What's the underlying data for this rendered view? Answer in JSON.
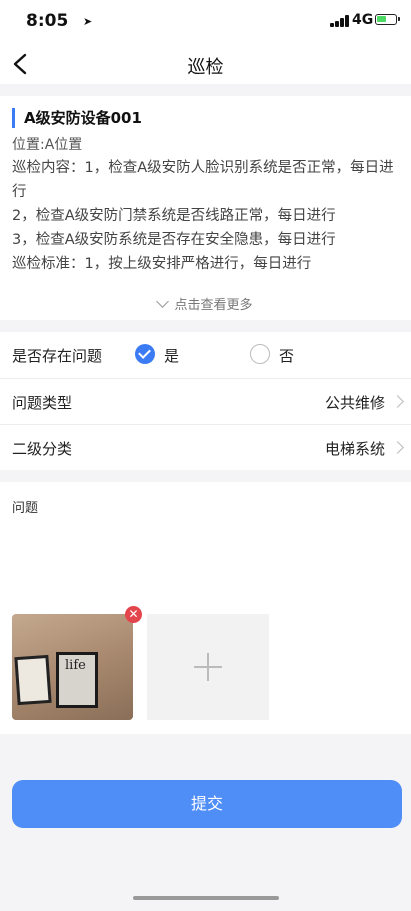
{
  "status_bar": {
    "time": "8:05",
    "network": "4G"
  },
  "nav": {
    "title": "巡检"
  },
  "device": {
    "title": "A级安防设备001",
    "location": "位置:A位置",
    "content_lines": [
      "巡检内容：1，检查A级安防人脸识别系统是否正常，每日进行",
      "2，检查A级安防门禁系统是否线路正常，每日进行",
      "3，检查A级安防系统是否存在安全隐患，每日进行",
      "巡检标准：1，按上级安排严格进行，每日进行"
    ],
    "more_label": "点击查看更多"
  },
  "form": {
    "has_problem": {
      "label": "是否存在问题",
      "yes": "是",
      "no": "否",
      "selected": "是"
    },
    "problem_type": {
      "label": "问题类型",
      "value": "公共维修"
    },
    "secondary_category": {
      "label": "二级分类",
      "value": "电梯系统"
    }
  },
  "problem": {
    "label": "问题",
    "photo_text": "life"
  },
  "submit_label": "提交",
  "colors": {
    "accent": "#3b7cf5",
    "button": "#4f8df7",
    "delete": "#e3454d"
  }
}
